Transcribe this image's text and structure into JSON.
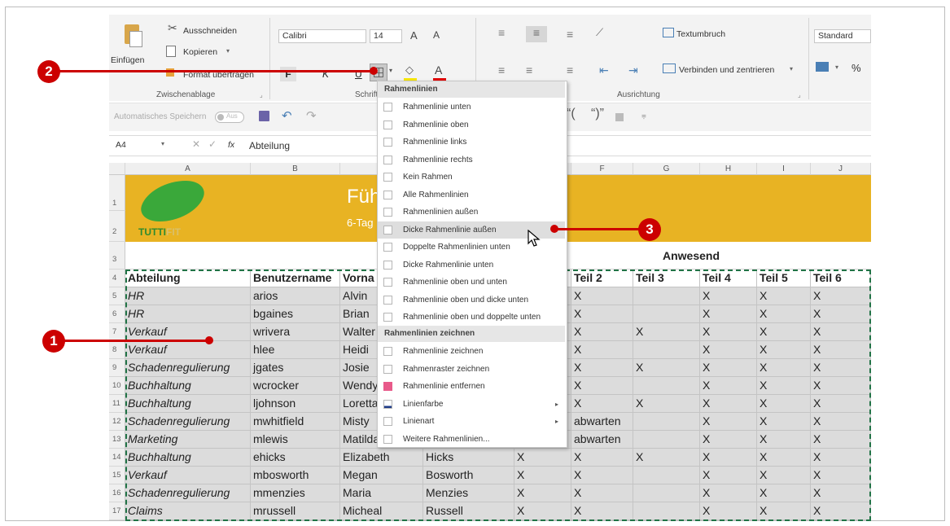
{
  "ribbon": {
    "clipboard": {
      "paste": "Einfügen",
      "cut": "Ausschneiden",
      "copy": "Kopieren",
      "format_painter": "Format übertragen",
      "group": "Zwischenablage"
    },
    "font": {
      "name": "Calibri",
      "size": "14",
      "group": "Schrift",
      "grow": "A",
      "shrink": "A",
      "bold": "F",
      "italic": "K",
      "underline": "U",
      "font_color": "A"
    },
    "alignment": {
      "wrap": "Textumbruch",
      "merge": "Verbinden und zentrieren",
      "group": "Ausrichtung"
    },
    "number": {
      "format": "Standard",
      "percent": "%"
    }
  },
  "qat": {
    "autosave": "Automatisches Speichern",
    "autosave_state": "Aus"
  },
  "formula_bar": {
    "name_box": "A4",
    "fx": "fx",
    "value": "Abteilung"
  },
  "sheet": {
    "columns": [
      "A",
      "B",
      "C",
      "D",
      "E",
      "F",
      "G",
      "H",
      "I",
      "J"
    ],
    "title_partial": "Füh",
    "subtitle_partial": "6-Tag",
    "logo_text_visible": "TUTTI",
    "logo_text_faded": "FIT",
    "anwesend": "Anwesend",
    "headers": [
      "Abteilung",
      "Benutzername",
      "Vorna",
      "",
      "",
      "Teil 2",
      "Teil 3",
      "Teil 4",
      "Teil 5",
      "Teil 6"
    ],
    "rows": [
      {
        "num": "5",
        "a": "HR",
        "b": "arios",
        "c": "Alvin",
        "d": "",
        "e": "",
        "f": "X",
        "g": "",
        "h": "X",
        "i": "X",
        "j": "X"
      },
      {
        "num": "6",
        "a": "HR",
        "b": "bgaines",
        "c": "Brian",
        "d": "",
        "e": "",
        "f": "X",
        "g": "",
        "h": "X",
        "i": "X",
        "j": "X"
      },
      {
        "num": "7",
        "a": "Verkauf",
        "b": "wrivera",
        "c": "Walter",
        "d": "",
        "e": "",
        "f": "X",
        "g": "X",
        "h": "X",
        "i": "X",
        "j": "X"
      },
      {
        "num": "8",
        "a": "Verkauf",
        "b": "hlee",
        "c": "Heidi",
        "d": "",
        "e": "",
        "f": "X",
        "g": "",
        "h": "X",
        "i": "X",
        "j": "X"
      },
      {
        "num": "9",
        "a": "Schadenregulierung",
        "b": "jgates",
        "c": "Josie",
        "d": "",
        "e": "",
        "f": "X",
        "g": "X",
        "h": "X",
        "i": "X",
        "j": "X"
      },
      {
        "num": "10",
        "a": "Buchhaltung",
        "b": "wcrocker",
        "c": "Wendy",
        "d": "",
        "e": "",
        "f": "X",
        "g": "",
        "h": "X",
        "i": "X",
        "j": "X"
      },
      {
        "num": "11",
        "a": "Buchhaltung",
        "b": "ljohnson",
        "c": "Loretta",
        "d": "",
        "e": "",
        "f": "X",
        "g": "X",
        "h": "X",
        "i": "X",
        "j": "X"
      },
      {
        "num": "12",
        "a": "Schadenregulierung",
        "b": "mwhitfield",
        "c": "Misty",
        "d": "",
        "e": "",
        "f": "abwarten",
        "g": "",
        "h": "X",
        "i": "X",
        "j": "X"
      },
      {
        "num": "13",
        "a": "Marketing",
        "b": "mlewis",
        "c": "Matilda",
        "d": "",
        "e": "",
        "f": "abwarten",
        "g": "",
        "h": "X",
        "i": "X",
        "j": "X"
      },
      {
        "num": "14",
        "a": "Buchhaltung",
        "b": "ehicks",
        "c": "Elizabeth",
        "d": "Hicks",
        "e": "X",
        "f": "X",
        "g": "X",
        "h": "X",
        "i": "X",
        "j": "X"
      },
      {
        "num": "15",
        "a": "Verkauf",
        "b": "mbosworth",
        "c": "Megan",
        "d": "Bosworth",
        "e": "X",
        "f": "X",
        "g": "",
        "h": "X",
        "i": "X",
        "j": "X"
      },
      {
        "num": "16",
        "a": "Schadenregulierung",
        "b": "mmenzies",
        "c": "Maria",
        "d": "Menzies",
        "e": "X",
        "f": "X",
        "g": "",
        "h": "X",
        "i": "X",
        "j": "X"
      },
      {
        "num": "17",
        "a": "Claims",
        "b": "mrussell",
        "c": "Micheal",
        "d": "Russell",
        "e": "X",
        "f": "X",
        "g": "",
        "h": "X",
        "i": "X",
        "j": "X"
      }
    ]
  },
  "menu": {
    "header1": "Rahmenlinien",
    "items1": [
      "Rahmenlinie unten",
      "Rahmenlinie oben",
      "Rahmenlinie links",
      "Rahmenlinie rechts",
      "Kein Rahmen",
      "Alle Rahmenlinien",
      "Rahmenlinien außen",
      "Dicke Rahmenlinie außen",
      "Doppelte Rahmenlinien unten",
      "Dicke Rahmenlinie unten",
      "Rahmenlinie oben und unten",
      "Rahmenlinie oben und dicke unten",
      "Rahmenlinie oben und doppelte unten"
    ],
    "header2": "Rahmenlinien zeichnen",
    "items2": [
      "Rahmenlinie zeichnen",
      "Rahmenraster zeichnen",
      "Rahmenlinie entfernen",
      "Linienfarbe",
      "Linienart",
      "Weitere Rahmenlinien..."
    ]
  },
  "callouts": [
    "1",
    "2",
    "3"
  ],
  "colors": {
    "accent": "#cc0000",
    "banner": "#e8b323",
    "selection": "#dcdcdc",
    "grid_border": "#217346"
  }
}
